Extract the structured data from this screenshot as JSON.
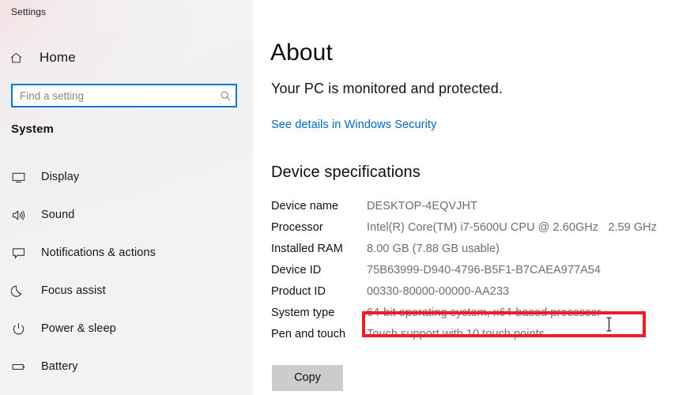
{
  "window": {
    "title": "Settings"
  },
  "sidebar": {
    "home": {
      "label": "Home",
      "icon": "home-icon"
    },
    "search": {
      "value": "",
      "placeholder": "Find a setting",
      "icon": "search-icon",
      "focused": true,
      "focus_color": "#0078d4"
    },
    "group_title": "System",
    "items": [
      {
        "label": "Display",
        "icon": "monitor-icon"
      },
      {
        "label": "Sound",
        "icon": "speaker-icon"
      },
      {
        "label": "Notifications & actions",
        "icon": "chat-bubble-icon"
      },
      {
        "label": "Focus assist",
        "icon": "moon-icon"
      },
      {
        "label": "Power & sleep",
        "icon": "power-icon"
      },
      {
        "label": "Battery",
        "icon": "battery-icon"
      }
    ]
  },
  "main": {
    "page_title": "About",
    "subtitle": "Your PC is monitored and protected.",
    "security_link": "See details in Windows Security",
    "security_link_color": "#0067c0",
    "section_title": "Device specifications",
    "specs": [
      {
        "key": "Device name",
        "value": "DESKTOP-4EQVJHT"
      },
      {
        "key": "Processor",
        "value": "Intel(R) Core(TM) i7-5600U CPU @ 2.60GHz   2.59 GHz"
      },
      {
        "key": "Installed RAM",
        "value": "8.00 GB (7.88 GB usable)"
      },
      {
        "key": "Device ID",
        "value": "75B63999-D940-4796-B5F1-B7CAEA977A54"
      },
      {
        "key": "Product ID",
        "value": "00330-80000-00000-AA233"
      },
      {
        "key": "System type",
        "value": "64-bit operating system, x64-based processor"
      },
      {
        "key": "Pen and touch",
        "value": "Touch support with 10 touch points"
      }
    ],
    "copy_button": "Copy"
  },
  "overlay": {
    "highlight_color": "#ee1c25",
    "highlight_target": "System type",
    "cursor": "text-ibeam-cursor"
  }
}
